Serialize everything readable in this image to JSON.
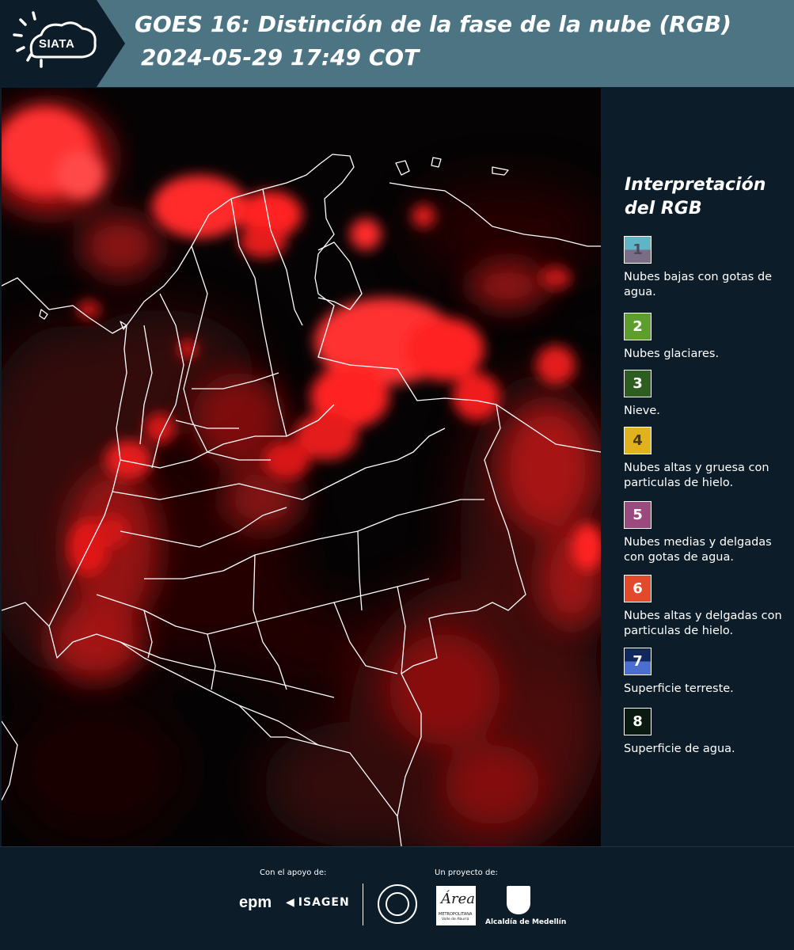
{
  "header": {
    "logo_text": "SIATA",
    "title_line1": "GOES 16: Distinción de la fase de la nube (RGB)",
    "title_line2": "2024-05-29 17:49 COT"
  },
  "legend": {
    "title_line1": "Interpretación",
    "title_line2": "del RGB",
    "items": [
      {
        "number": "1",
        "label": "Nubes bajas con gotas de agua.",
        "color_top": "#5fb5c6",
        "color_bottom": "#7a6d86"
      },
      {
        "number": "2",
        "label": "Nubes glaciares.",
        "color_top": "#5e9e2e",
        "color_bottom": "#5e9e2e"
      },
      {
        "number": "3",
        "label": "Nieve.",
        "color_top": "#2d5d1f",
        "color_bottom": "#2d5d1f"
      },
      {
        "number": "4",
        "label": "Nubes altas y gruesa con particulas de hielo.",
        "color_top": "#e0b21e",
        "color_bottom": "#e0b21e"
      },
      {
        "number": "5",
        "label": "Nubes medias y delgadas con gotas de agua.",
        "color_top": "#9b4a7e",
        "color_bottom": "#9b4a7e"
      },
      {
        "number": "6",
        "label": "Nubes altas y delgadas con particulas de hielo.",
        "color_top": "#e24a2c",
        "color_bottom": "#e24a2c"
      },
      {
        "number": "7",
        "label": "Superficie terreste.",
        "color_top": "#11285e",
        "color_bottom": "#4a6fd0"
      },
      {
        "number": "8",
        "label": "Superficie de agua.",
        "color_top": "#0a1a10",
        "color_bottom": "#0a1a10"
      }
    ]
  },
  "footer": {
    "support_label": "Con el apoyo de:",
    "project_label": "Un proyecto de:",
    "epm_logo": "epm",
    "isagen_logo": "ISAGEN",
    "area_logo_main": "Área",
    "area_logo_sub1": "METROPOLITANA",
    "area_logo_sub2": "Valle de Aburrá",
    "medellin_label": "Alcaldía de Medellín"
  },
  "colors": {
    "header_bg": "#4d7483",
    "logo_bg": "#0c1c28",
    "page_bg": "#0c1c28",
    "cloud_red": "#ff2020",
    "border_white": "#ffffff"
  }
}
